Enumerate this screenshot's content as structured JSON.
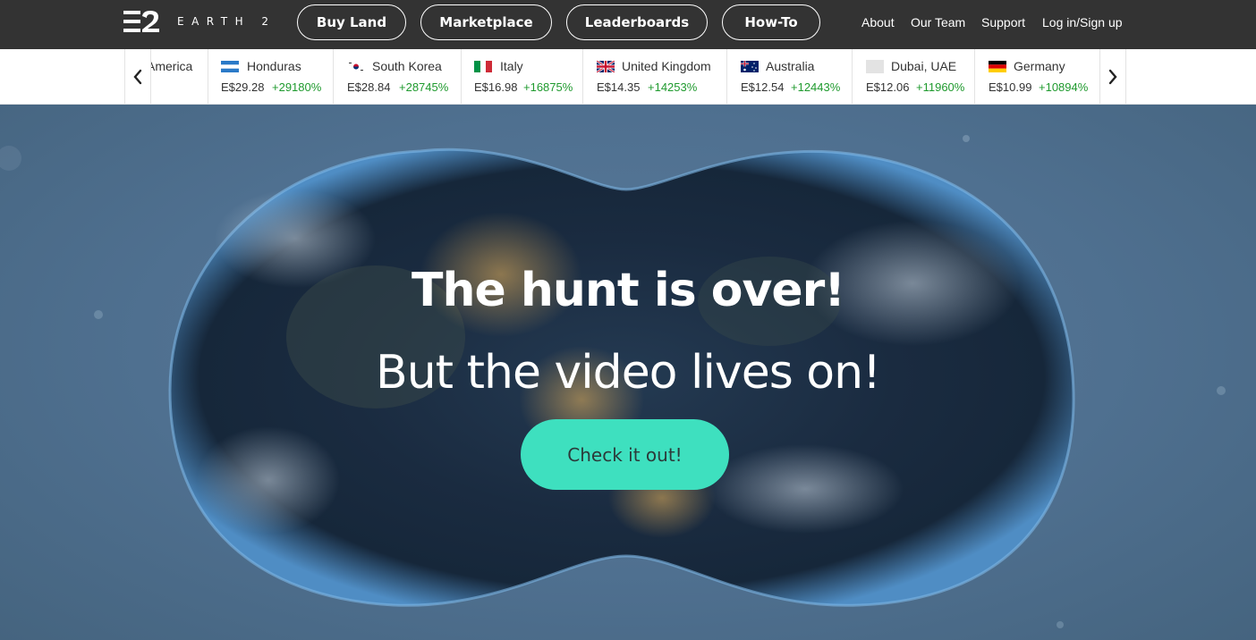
{
  "brand": {
    "logo_text": "EARTH 2"
  },
  "nav": {
    "pills": [
      "Buy Land",
      "Marketplace",
      "Leaderboards",
      "How-To"
    ],
    "links": [
      "About",
      "Our Team",
      "Support",
      "Log in/Sign up"
    ]
  },
  "ticker": {
    "items": [
      {
        "name": "America",
        "price": "",
        "change": ""
      },
      {
        "name": "Honduras",
        "price": "E$29.28",
        "change": "+29180%"
      },
      {
        "name": "South Korea",
        "price": "E$28.84",
        "change": "+28745%"
      },
      {
        "name": "Italy",
        "price": "E$16.98",
        "change": "+16875%"
      },
      {
        "name": "United Kingdom",
        "price": "E$14.35",
        "change": "+14253%"
      },
      {
        "name": "Australia",
        "price": "E$12.54",
        "change": "+12443%"
      },
      {
        "name": "Dubai, UAE",
        "price": "E$12.06",
        "change": "+11960%"
      },
      {
        "name": "Germany",
        "price": "E$10.99",
        "change": "+10894%"
      }
    ]
  },
  "hero": {
    "title": "The hunt is over!",
    "subtitle": "But the video lives on!",
    "cta": "Check it out!"
  },
  "colors": {
    "topbar": "#333333",
    "accent": "#3ee0bf",
    "positive": "#1f9a2e",
    "hero_bg": "#4f7090"
  }
}
